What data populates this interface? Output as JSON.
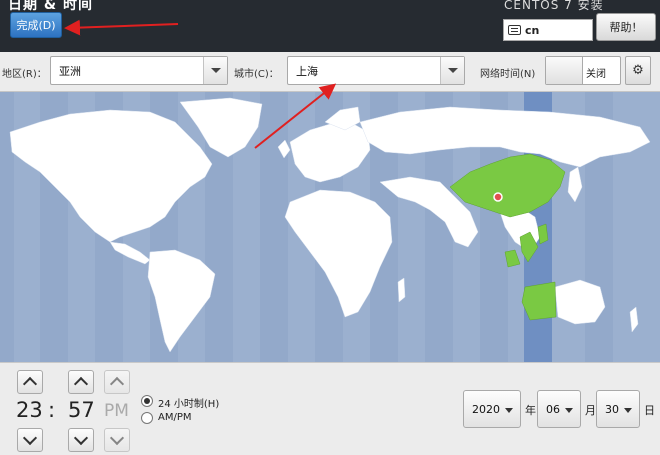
{
  "header": {
    "title": "日期 & 时间",
    "done_label": "完成(D)",
    "installer_title": "CENTOS 7 安装",
    "keyboard_layout": "cn",
    "help_label": "帮助！"
  },
  "toolbar": {
    "region_label": "地区(R)：",
    "region_value": "亚洲",
    "city_label": "城市(C)：",
    "city_value": "上海",
    "ntp_label": "网络时间(N)",
    "ntp_state": "关闭",
    "settings_icon": "gear-icon"
  },
  "map": {
    "selected_timezone_color": "#7ac943",
    "ocean_color": "#9bb0cf",
    "highlight_band_color": "#6f8fc2",
    "selected_city_marker": "上海"
  },
  "time": {
    "hours": "23",
    "separator": ":",
    "minutes": "57",
    "ampm": "PM",
    "format_24h_label": "24 小时制(H)",
    "format_ampm_label": "AM/PM",
    "format_selected": "24h"
  },
  "date": {
    "year": "2020",
    "year_unit": "年",
    "month": "06",
    "month_unit": "月",
    "day": "30",
    "day_unit": "日"
  },
  "colors": {
    "header_bg": "#262b31",
    "accent_button": "#3b82c9",
    "annotation_arrow": "#e02020"
  }
}
